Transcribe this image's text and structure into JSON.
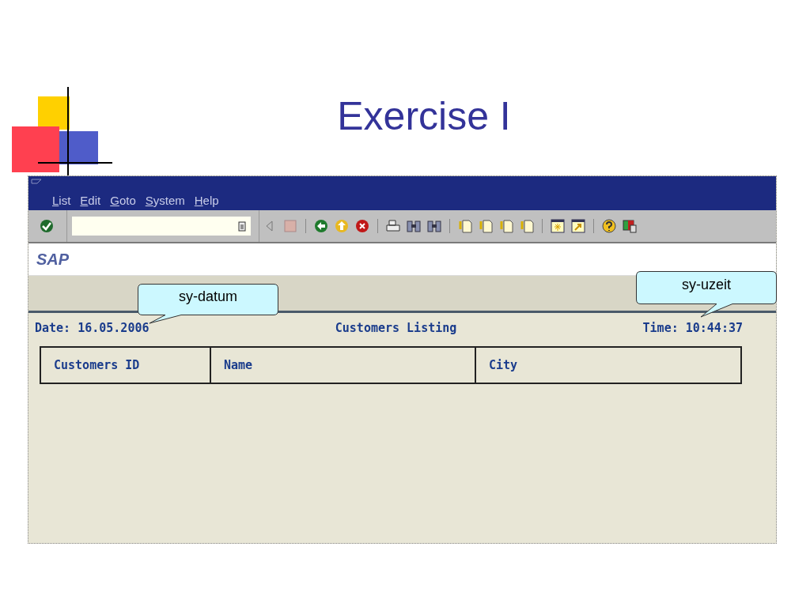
{
  "slide": {
    "title": "Exercise I"
  },
  "window": {
    "menu": [
      "List",
      "Edit",
      "Goto",
      "System",
      "Help"
    ],
    "logo": "SAP"
  },
  "report": {
    "date": "Date: 16.05.2006",
    "heading": "Customers Listing",
    "time": "Time: 10:44:37",
    "columns": [
      "Customers ID",
      "Name",
      "City"
    ]
  },
  "callouts": [
    {
      "text": "sy-datum"
    },
    {
      "text": "sy-uzeit"
    }
  ]
}
